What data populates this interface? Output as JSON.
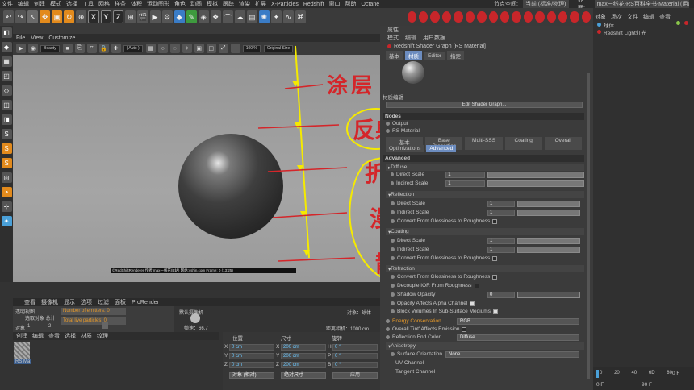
{
  "menubar": {
    "items": [
      "文件",
      "编辑",
      "创建",
      "模式",
      "选择",
      "工具",
      "网格",
      "样条",
      "体积",
      "运动图形",
      "角色",
      "动画",
      "模拟",
      "跟踪",
      "渲染",
      "扩展",
      "X-Particles",
      "Redshift",
      "窗口",
      "帮助",
      "Octane"
    ],
    "node_space_label": "节点空间:",
    "node_space_value": "当前 (标准/物理)",
    "layout_label": "界面:",
    "layout_value": "max一线花-RS百科全书-Material (用户)"
  },
  "toolbar": {
    "axis_x": "X",
    "axis_y": "Y",
    "axis_z": "Z"
  },
  "viewport": {
    "menu": [
      "查看",
      "摄像机",
      "显示",
      "选项",
      "过滤",
      "面板",
      "ProRender"
    ],
    "file_menu": [
      "File",
      "View",
      "Customize"
    ],
    "display_mode": "Beauty",
    "zoom_mode": "( Auto )",
    "zoom_value": "100 %",
    "size_mode": "Original Size",
    "render_info": "©RedShiftRenderer  作者:max一线花(B站)  网站:vshin.com  Frame: 0 (13:25)"
  },
  "handwriting": {
    "layer1": "涂层",
    "layer2": "反射",
    "layer3": "折射",
    "layer4": "漫射",
    "layer5": "散射",
    "circle_mark": "O"
  },
  "attributes": {
    "header": "属性",
    "menu": [
      "模式",
      "编辑",
      "用户数据"
    ],
    "title": "Redshift Shader Graph [RS Material]",
    "tabs": [
      "基本",
      "材质",
      "Editor",
      "指定"
    ],
    "active_tab": "材质",
    "material_name": "材质编辑",
    "edit_button": "Edit Shader Graph...",
    "nodes_label": "Nodes",
    "output_label": "Output",
    "rs_material_label": "RS Material",
    "mat_tabs": [
      "基本",
      "Base Properties",
      "Multi-SSS",
      "Coating",
      "Overall"
    ],
    "sub_tabs": [
      "Optimizations",
      "Advanced"
    ],
    "active_sub_tab": "Advanced",
    "advanced_label": "Advanced",
    "diffuse": {
      "label": "Diffuse",
      "direct_scale_label": "Direct Scale",
      "direct_scale": "1",
      "indirect_scale_label": "Indirect Scale",
      "indirect_scale": "1"
    },
    "reflection": {
      "label": "Reflection",
      "direct_scale_label": "Direct Scale",
      "direct_scale": "1",
      "indirect_scale_label": "Indirect Scale",
      "indirect_scale": "1",
      "convert_label": "Convert From Glossiness to Roughness"
    },
    "coating": {
      "label": "Coating",
      "direct_scale_label": "Direct Scale",
      "direct_scale": "1",
      "indirect_scale_label": "Indirect Scale",
      "indirect_scale": "1",
      "convert_label": "Convert From Glossiness to Roughness"
    },
    "refraction": {
      "label": "Refraction",
      "convert_label": "Convert From Glossiness to Roughness",
      "decouple_label": "Decouple IOR From Roughness",
      "shadow_opacity_label": "Shadow Opacity",
      "shadow_opacity": "0",
      "opacity_alpha_label": "Opacity Affects Alpha Channel",
      "block_volumes_label": "Block Volumes In Sub-Surface Mediums"
    },
    "energy_label": "Energy Conservation",
    "energy_value": "RGB",
    "overall_tint_label": "Overall Tint' Affects Emission",
    "reflection_end_label": "Reflection End Color",
    "reflection_end_value": "Diffuse",
    "anisotropy_label": "Anisotropy",
    "surface_orientation_label": "Surface Orientation",
    "surface_orientation_value": "None",
    "uv_channel_label": "UV Channel",
    "tangent_channel_label": "Tangent Channel"
  },
  "object_manager": {
    "tabs": [
      "对象",
      "场次"
    ],
    "menu": [
      "文件",
      "编辑",
      "查看"
    ],
    "items": [
      "球体",
      "Redshift Light灯光"
    ]
  },
  "timeline": {
    "ticks": [
      "0",
      "10",
      "20",
      "30",
      "40",
      "50",
      "60",
      "70",
      "80",
      "90"
    ],
    "tick_labels": [
      "0",
      "20",
      "40",
      "6D",
      "80"
    ],
    "current_frame": "0 F",
    "start_frame": "0 F",
    "end_frame": "90 F"
  },
  "info_panel": {
    "emitters_label": "Number of emitters: 0",
    "particles_label": "Total live particles: 0",
    "cpu_label": "透明视图",
    "selected_label": "选取对象 总计",
    "objects_label": "对象",
    "objects_count_1": "1",
    "objects_count_2": "2",
    "camera_label": "默认摄像机",
    "fps_label": "帧速：66.7",
    "object_info": "对象：球体",
    "distance_label": "距离相机：1000 cm"
  },
  "material_manager": {
    "menu": [
      "创建",
      "编辑",
      "查看",
      "选择",
      "材质",
      "纹理"
    ],
    "material_label": "RS Ma"
  },
  "coordinates": {
    "position_label": "位置",
    "size_label": "尺寸",
    "rotation_label": "旋转",
    "x_pos": "0 cm",
    "y_pos": "0 cm",
    "z_pos": "0 cm",
    "x_size": "200 cm",
    "y_size": "200 cm",
    "z_size": "200 cm",
    "h_rot": "0 °",
    "p_rot": "0 °",
    "b_rot": "0 °",
    "mode_object": "对象 (相对)",
    "mode_size": "绝对尺寸",
    "apply_button": "应用",
    "axis_x": "X",
    "axis_y": "Y",
    "axis_z": "Z",
    "axis_h": "H",
    "axis_p": "P",
    "axis_b": "B"
  }
}
